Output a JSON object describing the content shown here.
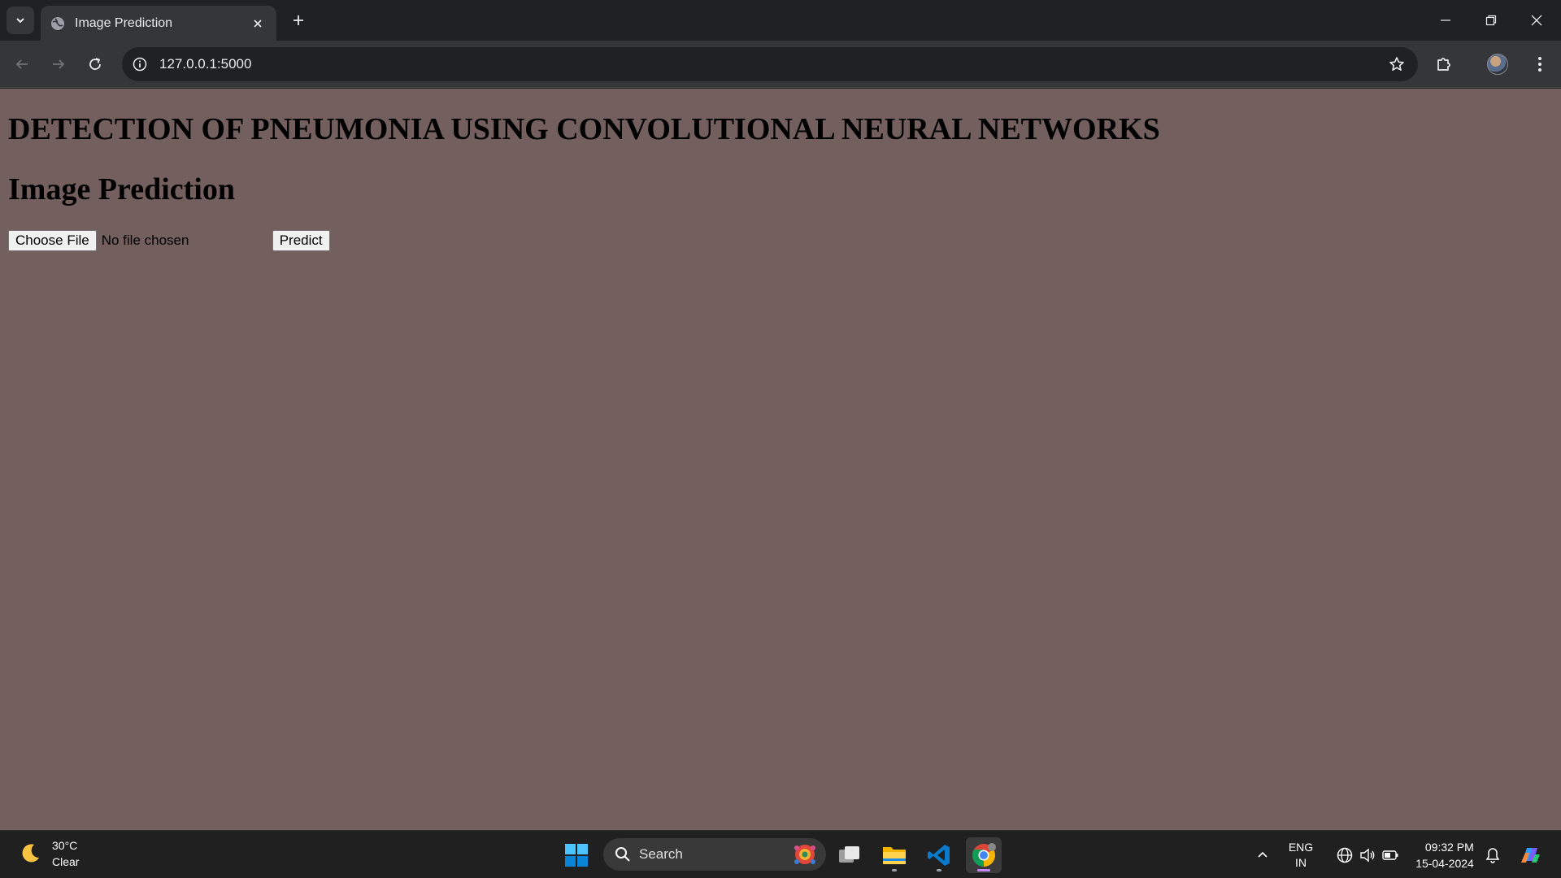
{
  "browser": {
    "tab": {
      "title": "Image Prediction"
    },
    "address_bar": {
      "url": "127.0.0.1:5000"
    }
  },
  "page": {
    "main_title": "DETECTION OF PNEUMONIA USING CONVOLUTIONAL NEURAL NETWORKS",
    "sub_title": "Image Prediction",
    "file_input": {
      "button_label": "Choose File",
      "status": "No file chosen"
    },
    "predict_button": "Predict",
    "background_color": "#745f5f"
  },
  "taskbar": {
    "weather": {
      "temperature": "30°C",
      "condition": "Clear"
    },
    "search_label": "Search",
    "language": {
      "line1": "ENG",
      "line2": "IN"
    },
    "clock": {
      "time": "09:32 PM",
      "date": "15-04-2024"
    }
  }
}
